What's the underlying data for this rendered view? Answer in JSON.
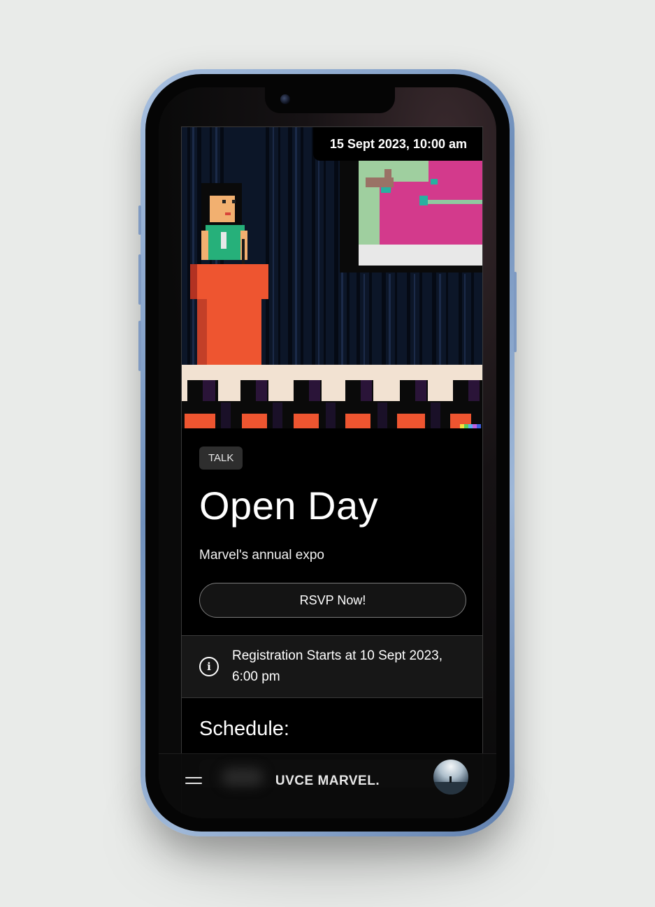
{
  "event": {
    "date": "15 Sept 2023, 10:00 am",
    "tag": "TALK",
    "title": "Open Day",
    "subtitle": "Marvel's annual expo",
    "rsvp_label": "RSVP Now!",
    "registration_info": "Registration Starts at 10 Sept 2023, 6:00 pm",
    "schedule_heading": "Schedule:"
  },
  "bottom_bar": {
    "brand": "UVCE MARVEL."
  },
  "icons": {
    "menu": "hamburger-menu-icon",
    "info": "info-circle-icon",
    "avatar": "user-avatar"
  },
  "colors": {
    "background": "#000000",
    "accent_orange": "#ee5530",
    "card": "#171717"
  }
}
